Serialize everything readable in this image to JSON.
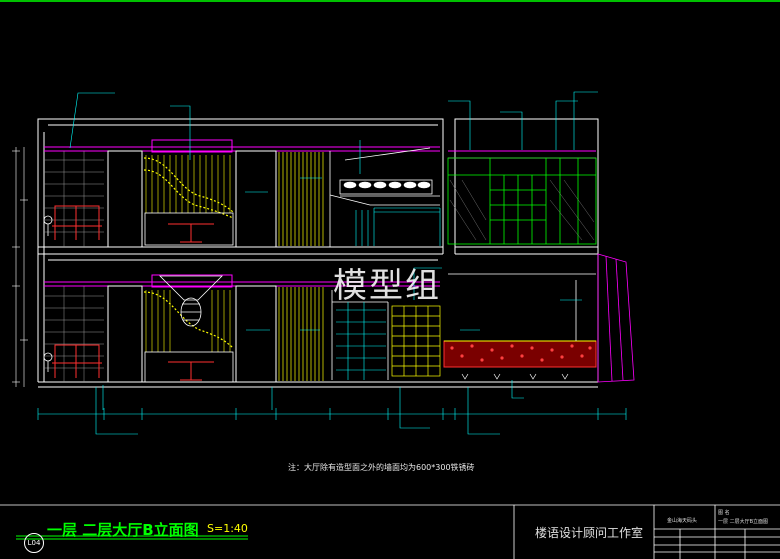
{
  "watermark": "模型组",
  "note": "注：大厅除有造型面之外的墙面均为600*300铁锈砖",
  "title_block": {
    "drawing_title": "一层  二层大厅B立面图",
    "scale": "S=1:40",
    "sheet_no": "L04",
    "studio": "楼语设计顾问工作室",
    "project": "金山海天码头",
    "name_label": "图  名",
    "drawing_name": "一层  二层大厅B立面图"
  },
  "colors": {
    "background": "#000000",
    "frame": "#00ff00",
    "wall": "#ffffff",
    "yellow": "#ffff00",
    "magenta": "#ff00ff",
    "cyan": "#00ffff",
    "red": "#ff3030",
    "green": "#00ff00"
  }
}
